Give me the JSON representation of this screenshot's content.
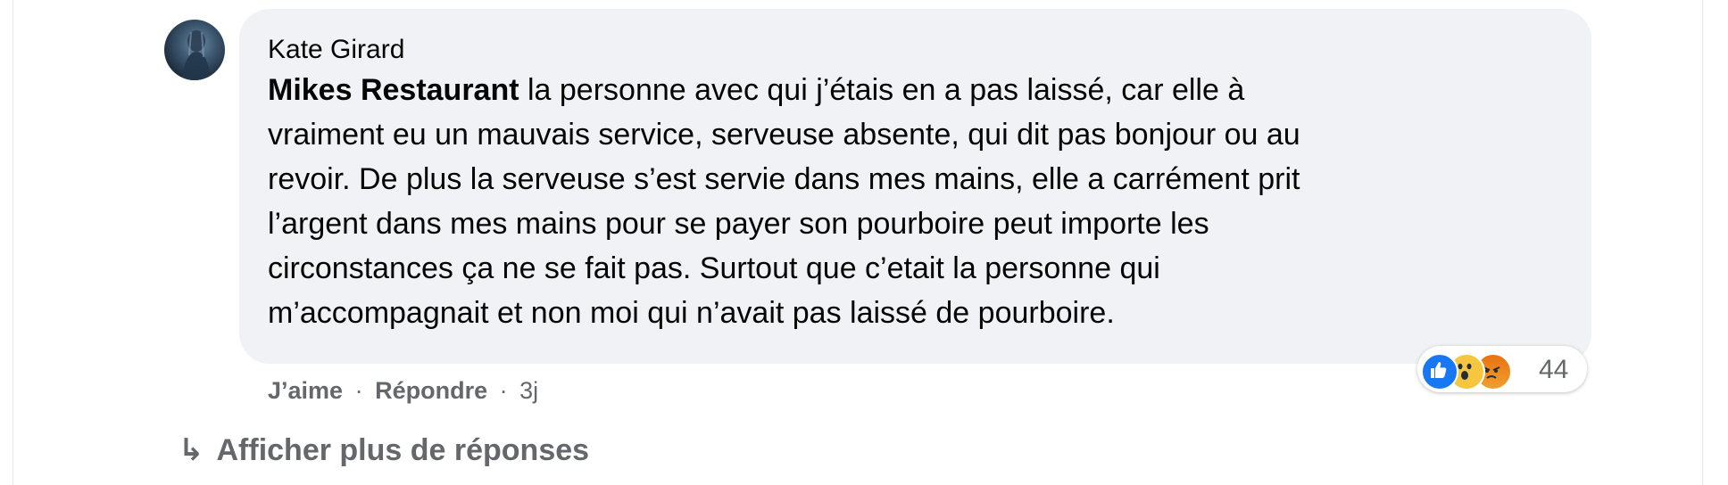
{
  "comment": {
    "author": "Kate Girard",
    "mention": "Mikes Restaurant",
    "lines": [
      " la personne avec qui j’étais en a pas laissé, car elle à",
      "vraiment eu un mauvais service, serveuse absente, qui dit pas bonjour ou au",
      "revoir. De plus la serveuse s’est servie dans mes mains, elle a carrément prit",
      "l’argent dans mes mains pour se payer son pourboire peut importe les",
      "circonstances ça ne se fait pas. Surtout que c’etait la personne qui",
      "m’accompagnait et non moi qui n’avait pas laissé de pourboire."
    ],
    "reactions": {
      "icons": [
        "like-icon",
        "wow-icon",
        "angry-icon"
      ],
      "count": "44"
    }
  },
  "actions": {
    "like": "J’aime",
    "separator": "·",
    "reply": "Répondre",
    "time": "3j"
  },
  "more_replies": {
    "arrow": "↳",
    "label": "Afficher plus de réponses"
  },
  "colors": {
    "bubble": "#f0f2f5",
    "secondary_text": "#65676b",
    "like_blue": "#1877f2"
  }
}
